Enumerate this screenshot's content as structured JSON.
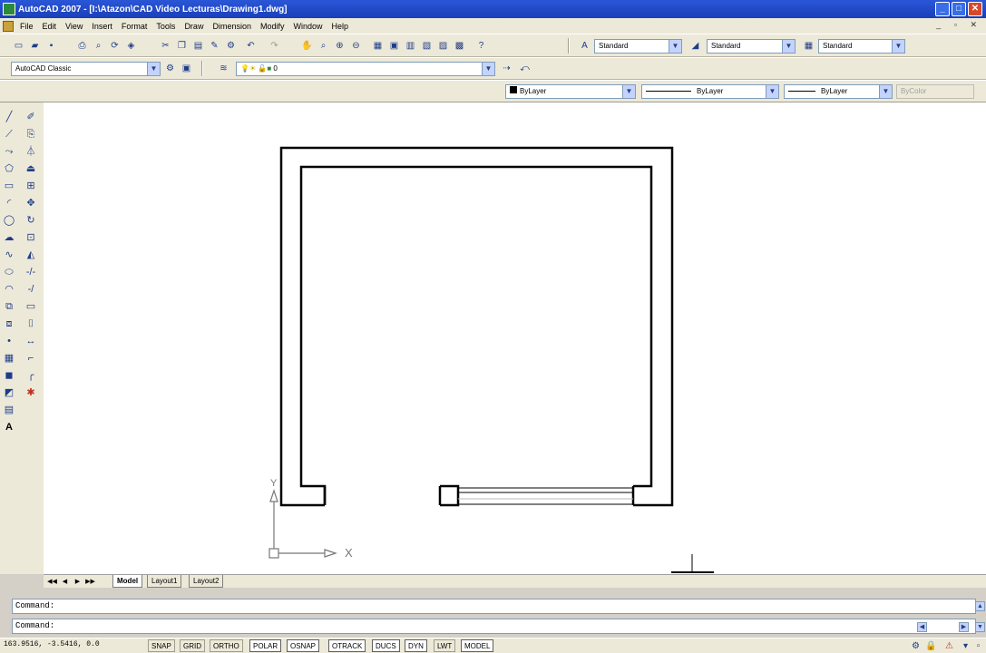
{
  "window": {
    "title": "AutoCAD 2007 - [I:\\Atazon\\CAD Video Lecturas\\Drawing1.dwg]",
    "controls": [
      "_",
      "□",
      "✕"
    ]
  },
  "menu": [
    "File",
    "Edit",
    "View",
    "Insert",
    "Format",
    "Tools",
    "Draw",
    "Dimension",
    "Modify",
    "Window",
    "Help"
  ],
  "toolbar": {
    "text_style": "Standard",
    "dim_style": "Standard",
    "table_style": "Standard",
    "workspace": "AutoCAD Classic",
    "layer": "0",
    "color": "ByLayer",
    "linetype": "ByLayer",
    "lineweight": "ByLayer",
    "plot_style": "ByColor"
  },
  "layout_tabs": {
    "tabs": [
      "Model",
      "Layout1",
      "Layout2"
    ],
    "active": "Model"
  },
  "ucs": {
    "x_label": "X",
    "y_label": "Y"
  },
  "command": {
    "line1": "Command:",
    "line2": "Command:"
  },
  "status": {
    "coords": "163.9516, -3.5416, 0.0",
    "toggles": [
      {
        "label": "SNAP",
        "on": false
      },
      {
        "label": "GRID",
        "on": false
      },
      {
        "label": "ORTHO",
        "on": false
      },
      {
        "label": "POLAR",
        "on": true
      },
      {
        "label": "OSNAP",
        "on": true
      },
      {
        "label": "OTRACK",
        "on": true
      },
      {
        "label": "DUCS",
        "on": true
      },
      {
        "label": "DYN",
        "on": true
      },
      {
        "label": "LWT",
        "on": false
      },
      {
        "label": "MODEL",
        "on": true
      }
    ]
  }
}
